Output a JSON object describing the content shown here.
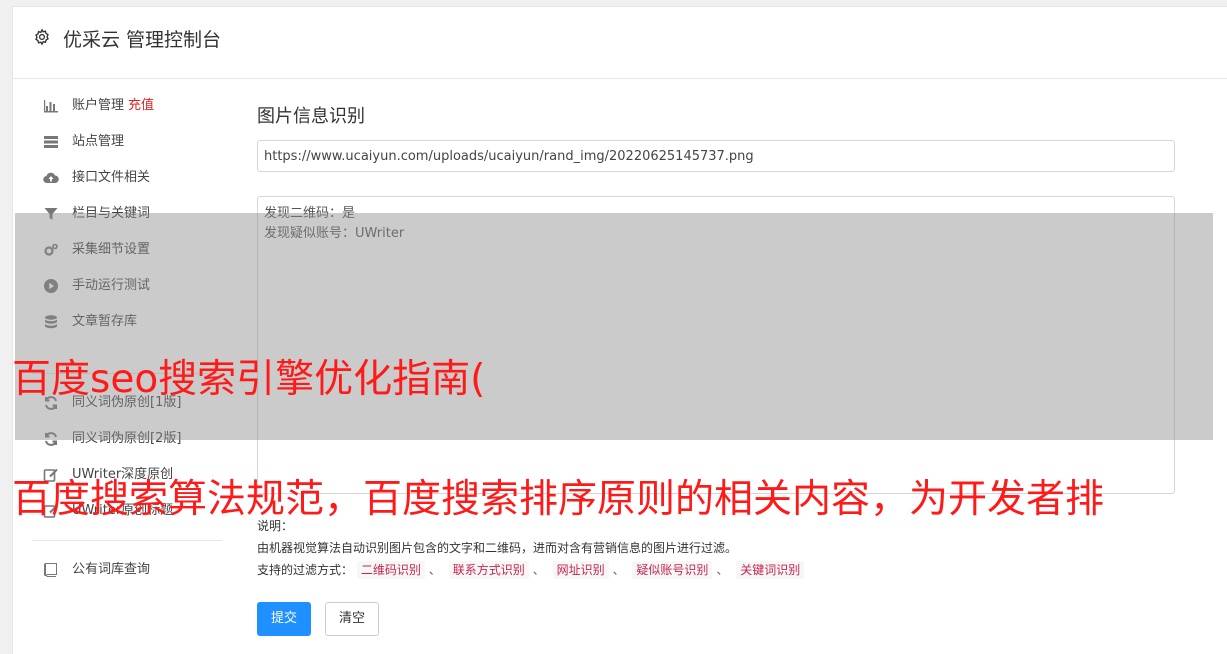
{
  "header": {
    "title": "优采云 管理控制台",
    "icon": "gear-icon"
  },
  "sidebar": {
    "items": [
      {
        "label": "账户管理",
        "badge": "充值",
        "icon": "bar-chart-icon"
      },
      {
        "label": "站点管理",
        "icon": "server-icon"
      },
      {
        "label": "接口文件相关",
        "icon": "cloud-upload-icon"
      },
      {
        "label": "栏目与关键词",
        "icon": "filter-icon"
      },
      {
        "label": "采集细节设置",
        "icon": "cogs-icon"
      },
      {
        "label": "手动运行测试",
        "icon": "play-circle-icon"
      },
      {
        "label": "文章暂存库",
        "icon": "database-icon"
      },
      {
        "label": "同义词伪原创[1版]",
        "icon": "refresh-icon"
      },
      {
        "label": "同义词伪原创[2版]",
        "icon": "refresh-icon"
      },
      {
        "label": "UWriter深度原创",
        "icon": "edit-icon"
      },
      {
        "label": "UWriter原创标题",
        "icon": "edit-icon"
      },
      {
        "label": "公有词库查询",
        "icon": "book-icon"
      }
    ]
  },
  "main": {
    "section_title": "图片信息识别",
    "url_value": "https://www.ucaiyun.com/uploads/ucaiyun/rand_img/20220625145737.png",
    "result_lines": [
      "发现二维码：是",
      "发现疑似账号：UWriter"
    ],
    "help_label": "说明：",
    "help_desc": "由机器视觉算法自动识别图片包含的文字和二维码，进而对含有营销信息的图片进行过滤。",
    "filters_label": "支持的过滤方式：",
    "filters": [
      "二维码识别",
      "联系方式识别",
      "网址识别",
      "疑似账号识别",
      "关键词识别"
    ],
    "filter_sep": "、",
    "submit_label": "提交",
    "clear_label": "清空"
  },
  "overlay": {
    "line1": "百度seo搜索引擎优化指南(",
    "line2": "百度搜索算法规范，百度搜索排序原则的相关内容，为开发者排"
  },
  "colors": {
    "primary": "#1e90ff",
    "badge": "#e02020",
    "overlay_text": "#ff1a1a",
    "tag_text": "#c7254e"
  }
}
